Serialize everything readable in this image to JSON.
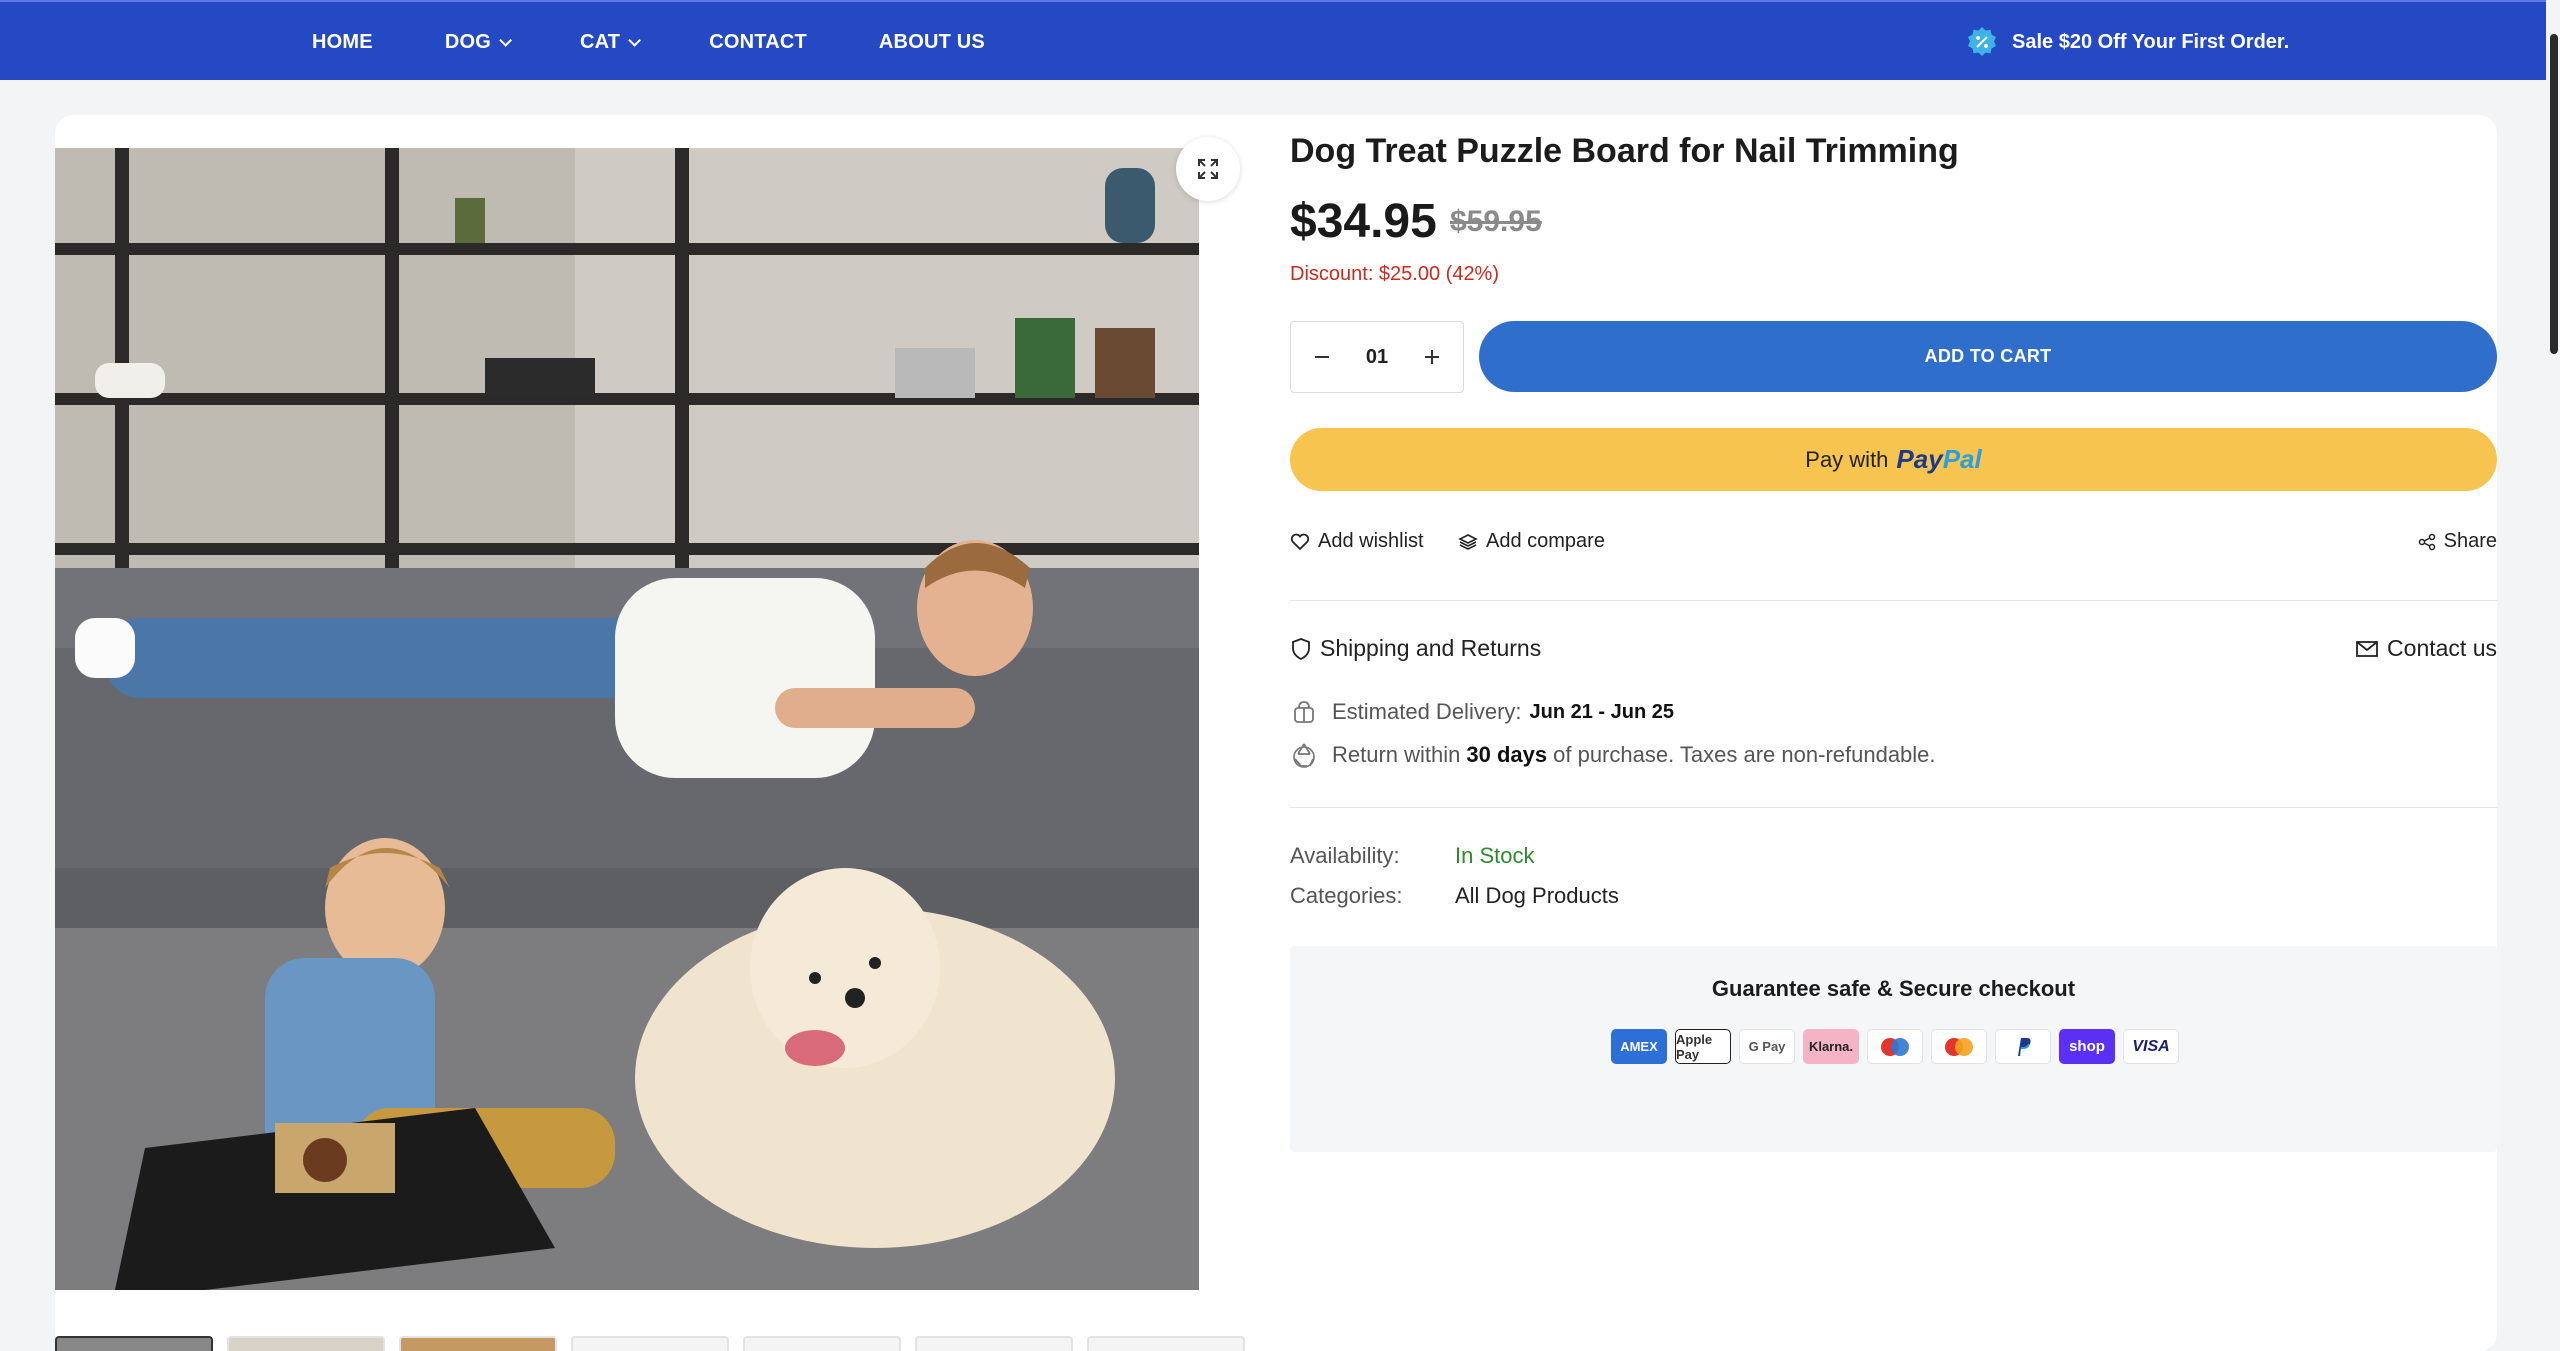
{
  "nav": {
    "items": [
      {
        "label": "HOME",
        "has_dropdown": false
      },
      {
        "label": "DOG",
        "has_dropdown": true
      },
      {
        "label": "CAT",
        "has_dropdown": true
      },
      {
        "label": "CONTACT",
        "has_dropdown": false
      },
      {
        "label": "ABOUT US",
        "has_dropdown": false
      }
    ],
    "promo_text": "Sale $20 Off Your First Order.",
    "promo_icon": "discount-badge-icon"
  },
  "colors": {
    "nav_bg": "#2449c3",
    "add_to_cart": "#2f6fcb",
    "paypal_button": "#f6c44f",
    "discount_text": "#d1281d",
    "in_stock": "#2e8b2e"
  },
  "product": {
    "title": "Dog Treat Puzzle Board for Nail Trimming",
    "price": "$34.95",
    "compare_price": "$59.95",
    "discount": "Discount: $25.00 (42%)",
    "quantity": "01",
    "add_to_cart_label": "ADD TO CART",
    "paypal_prefix": "Pay with",
    "paypal_brand_1": "Pay",
    "paypal_brand_2": "Pal",
    "add_wishlist": "Add wishlist",
    "add_compare": "Add compare",
    "share": "Share",
    "shipping_returns": "Shipping and Returns",
    "contact_us": "Contact us",
    "delivery_label": "Estimated Delivery:",
    "delivery_value": "Jun 21 - Jun 25",
    "return_prefix": "Return within",
    "return_days": "30 days",
    "return_suffix": "of purchase. Taxes are non-refundable.",
    "availability_label": "Availability:",
    "availability_value": "In Stock",
    "categories_label": "Categories:",
    "categories_value": "All Dog Products"
  },
  "checkout": {
    "title": "Guarantee safe & Secure checkout",
    "payment_methods": [
      "AMEX",
      "Apple Pay",
      "G Pay",
      "Klarna.",
      "Maestro",
      "Mastercard",
      "PayPal",
      "shop",
      "VISA"
    ]
  },
  "gallery": {
    "thumbnail_count": 7,
    "active_thumbnail": 1
  }
}
